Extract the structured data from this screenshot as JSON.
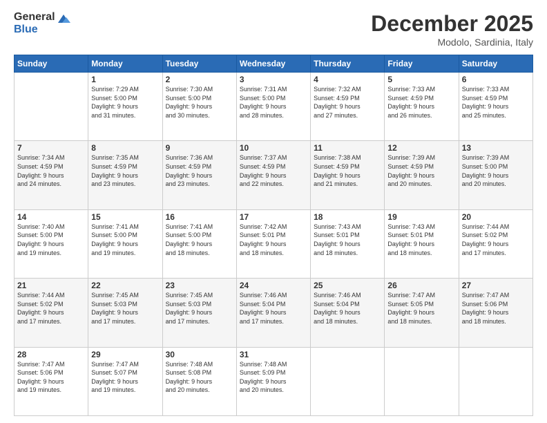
{
  "header": {
    "logo": {
      "general": "General",
      "blue": "Blue"
    },
    "title": "December 2025",
    "location": "Modolo, Sardinia, Italy"
  },
  "weekdays": [
    "Sunday",
    "Monday",
    "Tuesday",
    "Wednesday",
    "Thursday",
    "Friday",
    "Saturday"
  ],
  "weeks": [
    [
      {
        "day": "",
        "sunrise": "",
        "sunset": "",
        "daylight": "",
        "empty": true
      },
      {
        "day": "1",
        "sunrise": "Sunrise: 7:29 AM",
        "sunset": "Sunset: 5:00 PM",
        "daylight": "Daylight: 9 hours and 31 minutes."
      },
      {
        "day": "2",
        "sunrise": "Sunrise: 7:30 AM",
        "sunset": "Sunset: 5:00 PM",
        "daylight": "Daylight: 9 hours and 30 minutes."
      },
      {
        "day": "3",
        "sunrise": "Sunrise: 7:31 AM",
        "sunset": "Sunset: 5:00 PM",
        "daylight": "Daylight: 9 hours and 28 minutes."
      },
      {
        "day": "4",
        "sunrise": "Sunrise: 7:32 AM",
        "sunset": "Sunset: 4:59 PM",
        "daylight": "Daylight: 9 hours and 27 minutes."
      },
      {
        "day": "5",
        "sunrise": "Sunrise: 7:33 AM",
        "sunset": "Sunset: 4:59 PM",
        "daylight": "Daylight: 9 hours and 26 minutes."
      },
      {
        "day": "6",
        "sunrise": "Sunrise: 7:33 AM",
        "sunset": "Sunset: 4:59 PM",
        "daylight": "Daylight: 9 hours and 25 minutes."
      }
    ],
    [
      {
        "day": "7",
        "sunrise": "Sunrise: 7:34 AM",
        "sunset": "Sunset: 4:59 PM",
        "daylight": "Daylight: 9 hours and 24 minutes."
      },
      {
        "day": "8",
        "sunrise": "Sunrise: 7:35 AM",
        "sunset": "Sunset: 4:59 PM",
        "daylight": "Daylight: 9 hours and 23 minutes."
      },
      {
        "day": "9",
        "sunrise": "Sunrise: 7:36 AM",
        "sunset": "Sunset: 4:59 PM",
        "daylight": "Daylight: 9 hours and 23 minutes."
      },
      {
        "day": "10",
        "sunrise": "Sunrise: 7:37 AM",
        "sunset": "Sunset: 4:59 PM",
        "daylight": "Daylight: 9 hours and 22 minutes."
      },
      {
        "day": "11",
        "sunrise": "Sunrise: 7:38 AM",
        "sunset": "Sunset: 4:59 PM",
        "daylight": "Daylight: 9 hours and 21 minutes."
      },
      {
        "day": "12",
        "sunrise": "Sunrise: 7:39 AM",
        "sunset": "Sunset: 4:59 PM",
        "daylight": "Daylight: 9 hours and 20 minutes."
      },
      {
        "day": "13",
        "sunrise": "Sunrise: 7:39 AM",
        "sunset": "Sunset: 5:00 PM",
        "daylight": "Daylight: 9 hours and 20 minutes."
      }
    ],
    [
      {
        "day": "14",
        "sunrise": "Sunrise: 7:40 AM",
        "sunset": "Sunset: 5:00 PM",
        "daylight": "Daylight: 9 hours and 19 minutes."
      },
      {
        "day": "15",
        "sunrise": "Sunrise: 7:41 AM",
        "sunset": "Sunset: 5:00 PM",
        "daylight": "Daylight: 9 hours and 19 minutes."
      },
      {
        "day": "16",
        "sunrise": "Sunrise: 7:41 AM",
        "sunset": "Sunset: 5:00 PM",
        "daylight": "Daylight: 9 hours and 18 minutes."
      },
      {
        "day": "17",
        "sunrise": "Sunrise: 7:42 AM",
        "sunset": "Sunset: 5:01 PM",
        "daylight": "Daylight: 9 hours and 18 minutes."
      },
      {
        "day": "18",
        "sunrise": "Sunrise: 7:43 AM",
        "sunset": "Sunset: 5:01 PM",
        "daylight": "Daylight: 9 hours and 18 minutes."
      },
      {
        "day": "19",
        "sunrise": "Sunrise: 7:43 AM",
        "sunset": "Sunset: 5:01 PM",
        "daylight": "Daylight: 9 hours and 18 minutes."
      },
      {
        "day": "20",
        "sunrise": "Sunrise: 7:44 AM",
        "sunset": "Sunset: 5:02 PM",
        "daylight": "Daylight: 9 hours and 17 minutes."
      }
    ],
    [
      {
        "day": "21",
        "sunrise": "Sunrise: 7:44 AM",
        "sunset": "Sunset: 5:02 PM",
        "daylight": "Daylight: 9 hours and 17 minutes."
      },
      {
        "day": "22",
        "sunrise": "Sunrise: 7:45 AM",
        "sunset": "Sunset: 5:03 PM",
        "daylight": "Daylight: 9 hours and 17 minutes."
      },
      {
        "day": "23",
        "sunrise": "Sunrise: 7:45 AM",
        "sunset": "Sunset: 5:03 PM",
        "daylight": "Daylight: 9 hours and 17 minutes."
      },
      {
        "day": "24",
        "sunrise": "Sunrise: 7:46 AM",
        "sunset": "Sunset: 5:04 PM",
        "daylight": "Daylight: 9 hours and 17 minutes."
      },
      {
        "day": "25",
        "sunrise": "Sunrise: 7:46 AM",
        "sunset": "Sunset: 5:04 PM",
        "daylight": "Daylight: 9 hours and 18 minutes."
      },
      {
        "day": "26",
        "sunrise": "Sunrise: 7:47 AM",
        "sunset": "Sunset: 5:05 PM",
        "daylight": "Daylight: 9 hours and 18 minutes."
      },
      {
        "day": "27",
        "sunrise": "Sunrise: 7:47 AM",
        "sunset": "Sunset: 5:06 PM",
        "daylight": "Daylight: 9 hours and 18 minutes."
      }
    ],
    [
      {
        "day": "28",
        "sunrise": "Sunrise: 7:47 AM",
        "sunset": "Sunset: 5:06 PM",
        "daylight": "Daylight: 9 hours and 19 minutes."
      },
      {
        "day": "29",
        "sunrise": "Sunrise: 7:47 AM",
        "sunset": "Sunset: 5:07 PM",
        "daylight": "Daylight: 9 hours and 19 minutes."
      },
      {
        "day": "30",
        "sunrise": "Sunrise: 7:48 AM",
        "sunset": "Sunset: 5:08 PM",
        "daylight": "Daylight: 9 hours and 20 minutes."
      },
      {
        "day": "31",
        "sunrise": "Sunrise: 7:48 AM",
        "sunset": "Sunset: 5:09 PM",
        "daylight": "Daylight: 9 hours and 20 minutes."
      },
      {
        "day": "",
        "sunrise": "",
        "sunset": "",
        "daylight": "",
        "empty": true
      },
      {
        "day": "",
        "sunrise": "",
        "sunset": "",
        "daylight": "",
        "empty": true
      },
      {
        "day": "",
        "sunrise": "",
        "sunset": "",
        "daylight": "",
        "empty": true
      }
    ]
  ]
}
